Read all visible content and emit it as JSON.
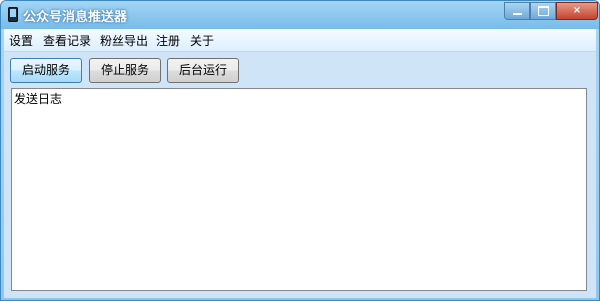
{
  "window": {
    "title": "公众号消息推送器",
    "controls": {
      "minimize": "minimize",
      "maximize": "maximize",
      "close": "×"
    }
  },
  "menu": {
    "items": [
      "设置",
      "查看记录",
      "粉丝导出",
      "注册",
      "关于"
    ]
  },
  "toolbar": {
    "start_label": "启动服务",
    "stop_label": "停止服务",
    "background_label": "后台运行"
  },
  "log": {
    "label": "发送日志"
  },
  "icons": {
    "app": "phone-icon",
    "minimize": "minimize-icon",
    "maximize": "maximize-icon",
    "close": "close-icon"
  },
  "colors": {
    "titlebar": "#78bbe9",
    "close_button": "#c4432c",
    "toolbar_bg": "#cfe5f7",
    "active_button": "#bee6fd"
  }
}
